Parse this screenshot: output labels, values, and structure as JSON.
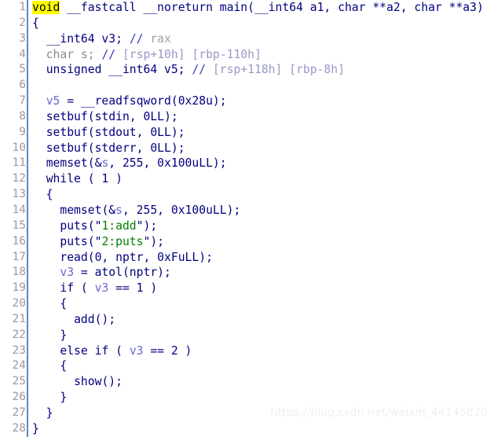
{
  "view": {
    "name": "pseudocode-view",
    "kind": "decompiler-pseudocode"
  },
  "watermark": {
    "text": "https://blog.csdn.net/weixin_44145820"
  },
  "colors": {
    "keyword": "#00007f",
    "local_variable": "#6767cc",
    "string_literal": "#008000",
    "comment": "#a0a0a0",
    "stack_annotation": "#9898c8",
    "highlight_background": "#ffff00",
    "gutter_number": "#9a9a9a",
    "gutter_rule": "#5b87c7",
    "background": "#ffffff"
  },
  "lines": [
    {
      "number": "1",
      "tokens": [
        {
          "t": "void",
          "c": "tok-kw-hl"
        },
        {
          "t": " __fastcall __noreturn ",
          "c": "tok-kw"
        },
        {
          "t": "main",
          "c": "tok-fn"
        },
        {
          "t": "(",
          "c": "tok-punct"
        },
        {
          "t": "__int64",
          "c": "tok-type"
        },
        {
          "t": " a1, ",
          "c": "tok-punct"
        },
        {
          "t": "char",
          "c": "tok-kw"
        },
        {
          "t": " **a2, ",
          "c": "tok-punct"
        },
        {
          "t": "char",
          "c": "tok-kw"
        },
        {
          "t": " **a3)",
          "c": "tok-punct"
        }
      ]
    },
    {
      "number": "2",
      "tokens": [
        {
          "t": "{",
          "c": "tok-punct"
        }
      ]
    },
    {
      "number": "3",
      "tokens": [
        {
          "t": "  ",
          "c": "tok-punct"
        },
        {
          "t": "__int64",
          "c": "tok-type"
        },
        {
          "t": " v3; ",
          "c": "tok-punct"
        },
        {
          "t": "//",
          "c": "tok-cmt-slash"
        },
        {
          "t": " rax",
          "c": "tok-cmt"
        }
      ]
    },
    {
      "number": "4",
      "tokens": [
        {
          "t": "  char s; ",
          "c": "tok-dim"
        },
        {
          "t": "//",
          "c": "tok-cmt-slash"
        },
        {
          "t": " [rsp+10h] [rbp-110h]",
          "c": "tok-stack"
        }
      ]
    },
    {
      "number": "5",
      "tokens": [
        {
          "t": "  ",
          "c": "tok-punct"
        },
        {
          "t": "unsigned __int64",
          "c": "tok-type"
        },
        {
          "t": " v5; ",
          "c": "tok-punct"
        },
        {
          "t": "//",
          "c": "tok-cmt-slash"
        },
        {
          "t": " [rsp+118h] [rbp-8h]",
          "c": "tok-stack"
        }
      ]
    },
    {
      "number": "6",
      "tokens": []
    },
    {
      "number": "7",
      "tokens": [
        {
          "t": "  ",
          "c": "tok-punct"
        },
        {
          "t": "v5",
          "c": "tok-lvar"
        },
        {
          "t": " = ",
          "c": "tok-punct"
        },
        {
          "t": "__readfsqword",
          "c": "tok-fn"
        },
        {
          "t": "(0x28u);",
          "c": "tok-punct"
        }
      ]
    },
    {
      "number": "8",
      "tokens": [
        {
          "t": "  ",
          "c": "tok-punct"
        },
        {
          "t": "setbuf",
          "c": "tok-fn"
        },
        {
          "t": "(stdin, 0LL);",
          "c": "tok-punct"
        }
      ]
    },
    {
      "number": "9",
      "tokens": [
        {
          "t": "  ",
          "c": "tok-punct"
        },
        {
          "t": "setbuf",
          "c": "tok-fn"
        },
        {
          "t": "(stdout, 0LL);",
          "c": "tok-punct"
        }
      ]
    },
    {
      "number": "10",
      "tokens": [
        {
          "t": "  ",
          "c": "tok-punct"
        },
        {
          "t": "setbuf",
          "c": "tok-fn"
        },
        {
          "t": "(stderr, 0LL);",
          "c": "tok-punct"
        }
      ]
    },
    {
      "number": "11",
      "tokens": [
        {
          "t": "  ",
          "c": "tok-punct"
        },
        {
          "t": "memset",
          "c": "tok-fn"
        },
        {
          "t": "(&",
          "c": "tok-punct"
        },
        {
          "t": "s",
          "c": "tok-lvar"
        },
        {
          "t": ", 255, 0x100uLL);",
          "c": "tok-punct"
        }
      ]
    },
    {
      "number": "12",
      "tokens": [
        {
          "t": "  ",
          "c": "tok-punct"
        },
        {
          "t": "while",
          "c": "tok-kw"
        },
        {
          "t": " ( 1 )",
          "c": "tok-punct"
        }
      ]
    },
    {
      "number": "13",
      "tokens": [
        {
          "t": "  {",
          "c": "tok-punct"
        }
      ]
    },
    {
      "number": "14",
      "tokens": [
        {
          "t": "    ",
          "c": "tok-punct"
        },
        {
          "t": "memset",
          "c": "tok-fn"
        },
        {
          "t": "(&",
          "c": "tok-punct"
        },
        {
          "t": "s",
          "c": "tok-lvar"
        },
        {
          "t": ", 255, 0x100uLL);",
          "c": "tok-punct"
        }
      ]
    },
    {
      "number": "15",
      "tokens": [
        {
          "t": "    ",
          "c": "tok-punct"
        },
        {
          "t": "puts",
          "c": "tok-fn"
        },
        {
          "t": "(\"",
          "c": "tok-quote"
        },
        {
          "t": "1:add",
          "c": "tok-str"
        },
        {
          "t": "\");",
          "c": "tok-quote"
        }
      ]
    },
    {
      "number": "16",
      "tokens": [
        {
          "t": "    ",
          "c": "tok-punct"
        },
        {
          "t": "puts",
          "c": "tok-fn"
        },
        {
          "t": "(\"",
          "c": "tok-quote"
        },
        {
          "t": "2:puts",
          "c": "tok-str"
        },
        {
          "t": "\");",
          "c": "tok-quote"
        }
      ]
    },
    {
      "number": "17",
      "tokens": [
        {
          "t": "    ",
          "c": "tok-punct"
        },
        {
          "t": "read",
          "c": "tok-fn"
        },
        {
          "t": "(0, nptr, 0xFuLL);",
          "c": "tok-punct"
        }
      ]
    },
    {
      "number": "18",
      "tokens": [
        {
          "t": "    ",
          "c": "tok-punct"
        },
        {
          "t": "v3",
          "c": "tok-lvar"
        },
        {
          "t": " = ",
          "c": "tok-punct"
        },
        {
          "t": "atol",
          "c": "tok-fn"
        },
        {
          "t": "(nptr);",
          "c": "tok-punct"
        }
      ]
    },
    {
      "number": "19",
      "tokens": [
        {
          "t": "    ",
          "c": "tok-punct"
        },
        {
          "t": "if",
          "c": "tok-kw"
        },
        {
          "t": " ( ",
          "c": "tok-punct"
        },
        {
          "t": "v3",
          "c": "tok-lvar"
        },
        {
          "t": " == 1 )",
          "c": "tok-punct"
        }
      ]
    },
    {
      "number": "20",
      "tokens": [
        {
          "t": "    {",
          "c": "tok-punct"
        }
      ]
    },
    {
      "number": "21",
      "tokens": [
        {
          "t": "      ",
          "c": "tok-punct"
        },
        {
          "t": "add",
          "c": "tok-fn"
        },
        {
          "t": "();",
          "c": "tok-punct"
        }
      ]
    },
    {
      "number": "22",
      "tokens": [
        {
          "t": "    }",
          "c": "tok-punct"
        }
      ]
    },
    {
      "number": "23",
      "tokens": [
        {
          "t": "    ",
          "c": "tok-punct"
        },
        {
          "t": "else if",
          "c": "tok-kw"
        },
        {
          "t": " ( ",
          "c": "tok-punct"
        },
        {
          "t": "v3",
          "c": "tok-lvar"
        },
        {
          "t": " == 2 )",
          "c": "tok-punct"
        }
      ]
    },
    {
      "number": "24",
      "tokens": [
        {
          "t": "    {",
          "c": "tok-punct"
        }
      ]
    },
    {
      "number": "25",
      "tokens": [
        {
          "t": "      ",
          "c": "tok-punct"
        },
        {
          "t": "show",
          "c": "tok-fn"
        },
        {
          "t": "();",
          "c": "tok-punct"
        }
      ]
    },
    {
      "number": "26",
      "tokens": [
        {
          "t": "    }",
          "c": "tok-punct"
        }
      ]
    },
    {
      "number": "27",
      "tokens": [
        {
          "t": "  }",
          "c": "tok-punct"
        }
      ]
    },
    {
      "number": "28",
      "tokens": [
        {
          "t": "}",
          "c": "tok-punct"
        }
      ]
    }
  ]
}
